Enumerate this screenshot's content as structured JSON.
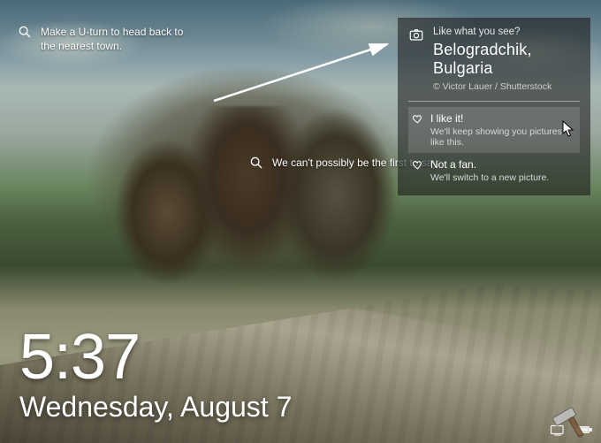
{
  "tips": {
    "left": "Make a U-turn to head back to the nearest town.",
    "mid": "We can't possibly be the first to say:"
  },
  "card": {
    "question": "Like what you see?",
    "title": "Belogradchik, Bulgaria",
    "credit": "© Victor Lauer / Shutterstock",
    "like": {
      "label": "I like it!",
      "sub": "We'll keep showing you pictures like this."
    },
    "nope": {
      "label": "Not a fan.",
      "sub": "We'll switch to a new picture."
    }
  },
  "clock": {
    "time": "5:37",
    "date": "Wednesday, August 7"
  }
}
